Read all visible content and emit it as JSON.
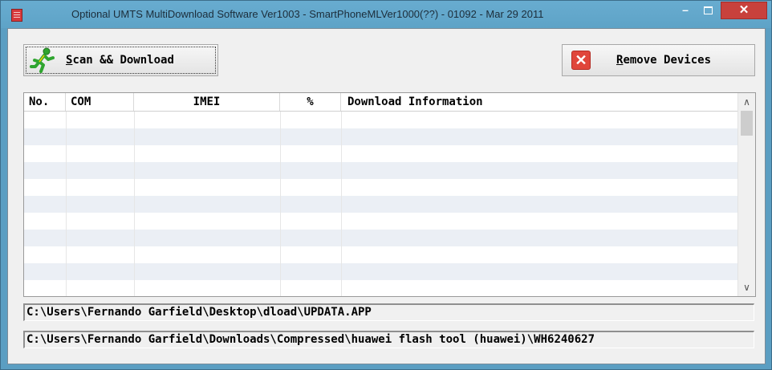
{
  "window": {
    "title": "Optional UMTS MultiDownload Software Ver1003 - SmartPhoneMLVer1000(??) - 01092 - Mar 29 2011",
    "min_glyph": "–",
    "close_glyph": "✕"
  },
  "toolbar": {
    "scan_prefix": "S",
    "scan_rest": "can && Download",
    "remove_prefix": "R",
    "remove_rest": "emove Devices"
  },
  "table": {
    "headers": [
      "No.",
      "COM",
      "IMEI",
      "%",
      "Download Information"
    ],
    "rows": []
  },
  "scrollbar": {
    "up": "∧",
    "down": "∨"
  },
  "paths": {
    "path1": "C:\\Users\\Fernando Garfield\\Desktop\\dload\\UPDATA.APP",
    "path2": "C:\\Users\\Fernando Garfield\\Downloads\\Compressed\\huawei flash tool (huawei)\\WH6240627"
  },
  "colors": {
    "titlebar": "#5ea3c7",
    "close": "#c8413c",
    "row_stripe": "#ebeff5"
  },
  "icons": {
    "app": "app-icon",
    "scan": "running-man-icon",
    "remove": "red-x-icon"
  }
}
